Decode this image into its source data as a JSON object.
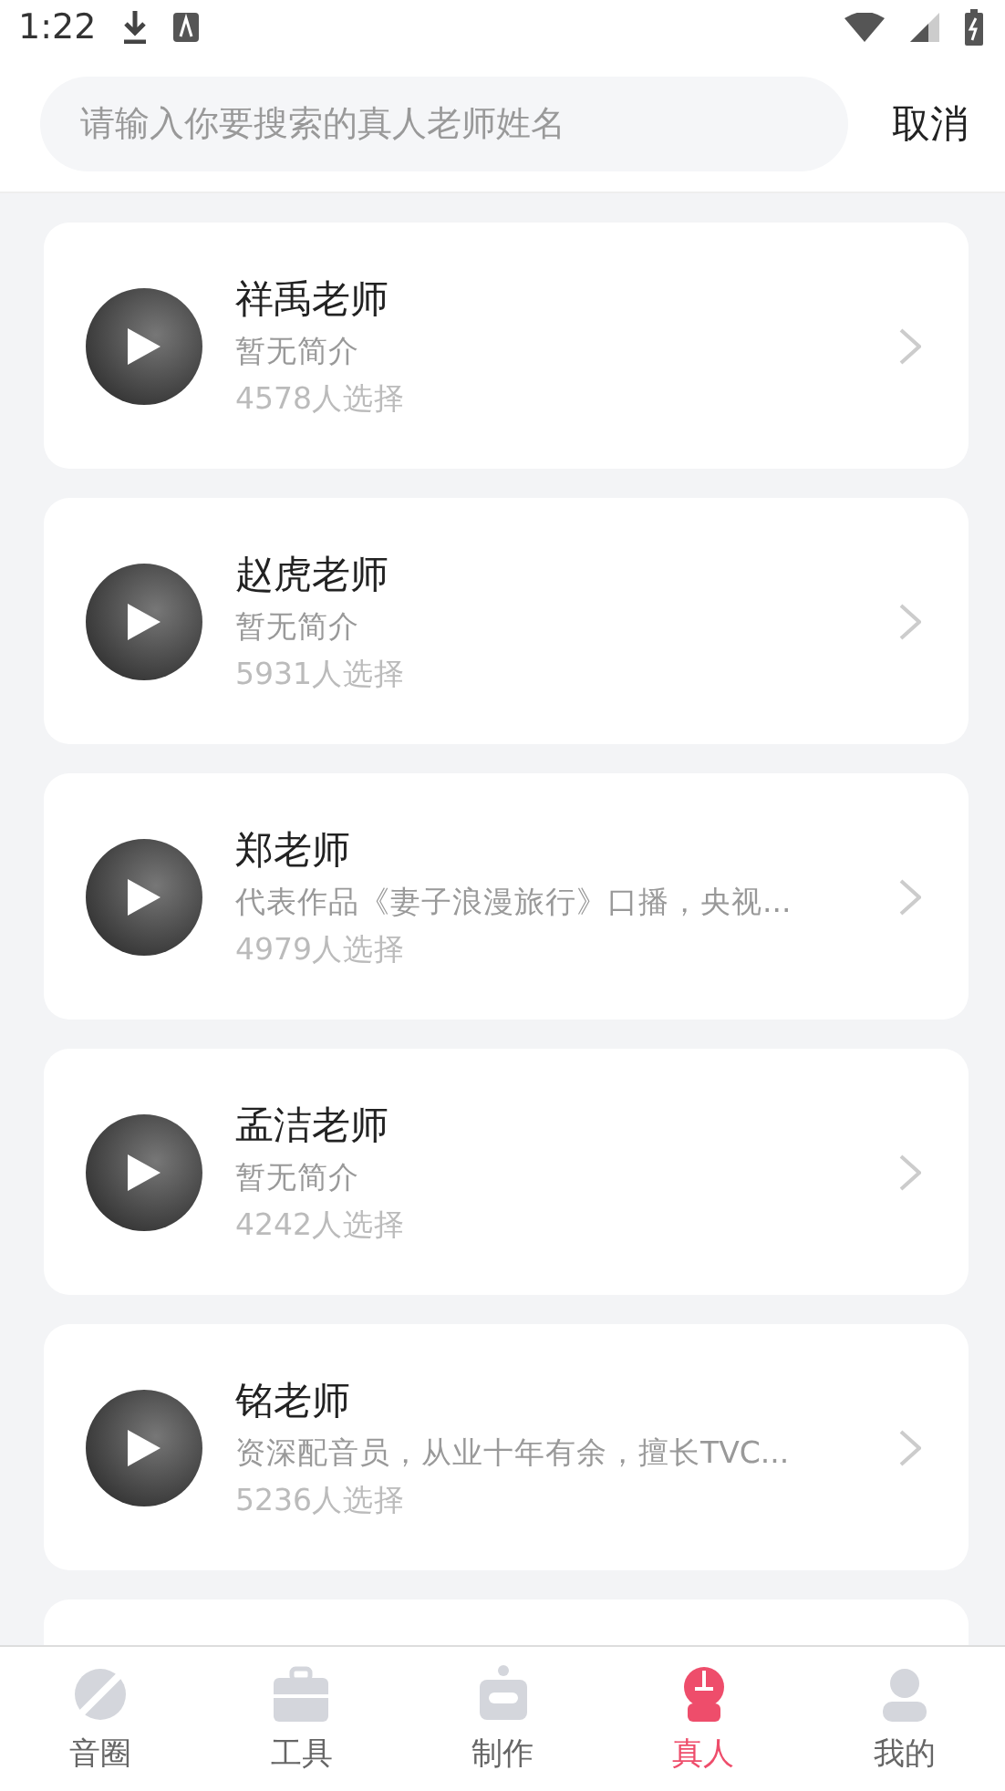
{
  "status_bar": {
    "time": "1:22"
  },
  "search": {
    "placeholder": "请输入你要搜索的真人老师姓名",
    "cancel": "取消"
  },
  "teachers": [
    {
      "name": "祥禹老师",
      "intro": "暂无简介",
      "count": "4578人选择"
    },
    {
      "name": "赵虎老师",
      "intro": "暂无简介",
      "count": "5931人选择"
    },
    {
      "name": "郑老师",
      "intro": "代表作品《妻子浪漫旅行》口播，央视...",
      "count": "4979人选择"
    },
    {
      "name": "孟洁老师",
      "intro": "暂无简介",
      "count": "4242人选择"
    },
    {
      "name": "铭老师",
      "intro": "资深配音员，从业十年有余，擅长TVC...",
      "count": "5236人选择"
    }
  ],
  "nav": [
    {
      "label": "音圈",
      "kind": "planet",
      "selected": false
    },
    {
      "label": "工具",
      "kind": "briefcase",
      "selected": false
    },
    {
      "label": "制作",
      "kind": "robot",
      "selected": false
    },
    {
      "label": "真人",
      "kind": "person",
      "selected": true
    },
    {
      "label": "我的",
      "kind": "user",
      "selected": false
    }
  ]
}
